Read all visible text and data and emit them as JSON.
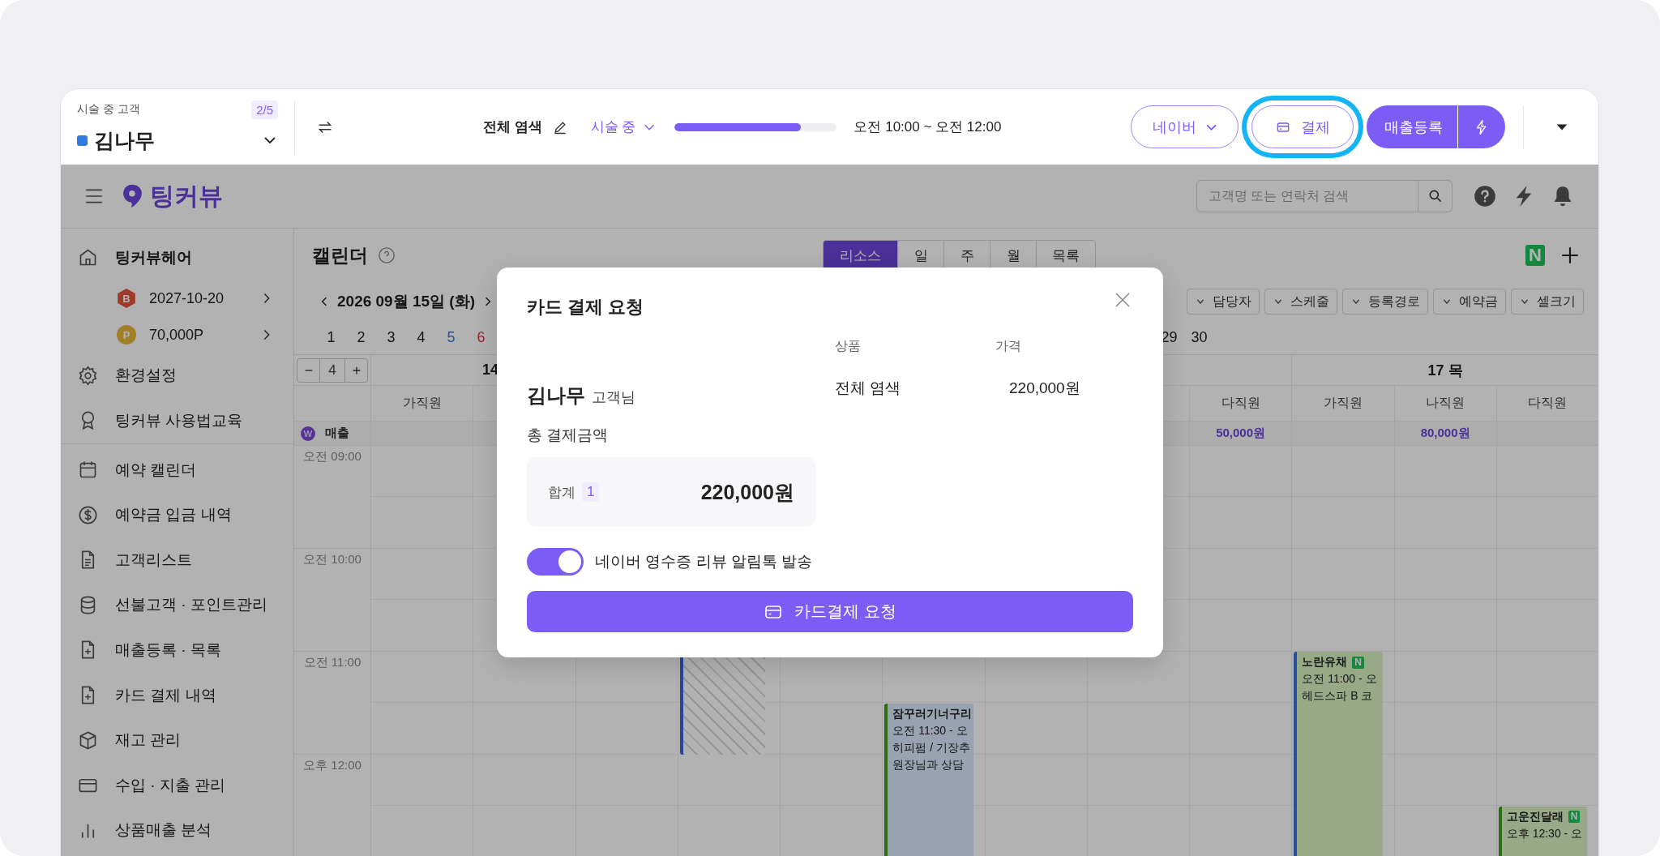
{
  "topbar": {
    "customer_label": "시술 중 고객",
    "counter": "2/5",
    "customer_name": "김나무",
    "service": "전체 염색",
    "status": "시술 중",
    "progress": {
      "level": 0.78
    },
    "time": "오전 10:00 ~ 오전 12:00",
    "buttons": [
      {
        "kind": "outline",
        "label": "네이버",
        "highlighted": false
      },
      {
        "kind": "pay",
        "label": "결제",
        "highlighted": true
      },
      {
        "kind": "primary",
        "label": "매출등록",
        "highlighted": false
      }
    ]
  },
  "app": {
    "logo": "팅커뷰",
    "search": {
      "placeholder": "고객명 또는 연락처 검색"
    },
    "sidebar": {
      "sections": [
        [
          {
            "kind": "shop",
            "label": "팅커뷰헤어"
          },
          {
            "kind": "sub",
            "badge": "B",
            "label": "2027-10-20"
          },
          {
            "kind": "sub",
            "badge": "P",
            "label": "70,000P"
          },
          {
            "kind": "menu",
            "label": "환경설정"
          },
          {
            "kind": "menu",
            "label": "팅커뷰 사용법교육"
          }
        ],
        [
          {
            "kind": "menu",
            "label": "예약 캘린더"
          },
          {
            "kind": "menu",
            "label": "예약금 입금 내역"
          },
          {
            "kind": "menu",
            "label": "고객리스트"
          },
          {
            "kind": "menu",
            "label": "선불고객 · 포인트관리"
          },
          {
            "kind": "menu",
            "label": "매출등록 · 목록"
          },
          {
            "kind": "menu",
            "label": "카드 결제 내역"
          },
          {
            "kind": "menu",
            "label": "재고 관리"
          },
          {
            "kind": "menu",
            "label": "수입 · 지출 관리"
          },
          {
            "kind": "menu",
            "label": "상품매출 분석"
          }
        ]
      ]
    },
    "calendar": {
      "title": "캘린더",
      "tabs": [
        {
          "label": "리소스",
          "selected": true
        },
        {
          "label": "일",
          "selected": false
        },
        {
          "label": "주",
          "selected": false
        },
        {
          "label": "월",
          "selected": false
        },
        {
          "label": "목록",
          "selected": false
        }
      ],
      "naver_badge": "N",
      "date": "2026 09월 15일 (화)",
      "filters": [
        "담당자",
        "스케줄",
        "등록경로",
        "예약금",
        "셀크기"
      ],
      "days_start": [
        {
          "label": "1",
          "kind": "weekday"
        },
        {
          "label": "2",
          "kind": "weekday"
        },
        {
          "label": "3",
          "kind": "weekday"
        },
        {
          "label": "4",
          "kind": "weekday"
        },
        {
          "label": "5",
          "kind": "saturday"
        },
        {
          "label": "6",
          "kind": "sunday"
        }
      ],
      "days_end": [
        {
          "label": "29",
          "kind": "weekday"
        },
        {
          "label": "30",
          "kind": "weekday"
        }
      ],
      "step_value": "4",
      "day_headers": [
        "14",
        "17 목"
      ],
      "sales_badge": "W",
      "sales_label": "매출",
      "staff": [
        "가직원",
        "다직원",
        "가직원",
        "나직원",
        "다직원"
      ],
      "sales": [
        "50,000원",
        "80,000원"
      ],
      "events": [
        {
          "kind": "blocked"
        },
        {
          "kind": "booking",
          "title": "잠꾸러기너구리",
          "lines": [
            "오전 11:30 - 오",
            "히피펌 / 기장추",
            "원장님과 상담"
          ]
        },
        {
          "kind": "booking",
          "title": "노란유채",
          "badge": "N",
          "lines": [
            "오전 11:00 - 오",
            "헤드스파 B 코"
          ]
        },
        {
          "kind": "booking",
          "title": "고운진달래",
          "badge": "N",
          "lines": [
            "오후 12:30 - 오"
          ]
        }
      ],
      "times": [
        "오전 09:00",
        "오전 10:00",
        "오전 11:00",
        "오후 12:00"
      ]
    }
  },
  "modal": {
    "title": "카드 결제 요청",
    "customer_name": "김나무",
    "customer_suffix": "고객님",
    "total_label": "총 결제금액",
    "sum_label": "합계",
    "sum_count": "1",
    "sum_amount": "220,000원",
    "columns": [
      "상품",
      "가격"
    ],
    "items": [
      {
        "name": "전체 염색",
        "price": "220,000원"
      }
    ],
    "toggle": {
      "label": "네이버 영수증 리뷰 알림톡 발송",
      "on": true
    },
    "submit": "카드결제 요청"
  }
}
